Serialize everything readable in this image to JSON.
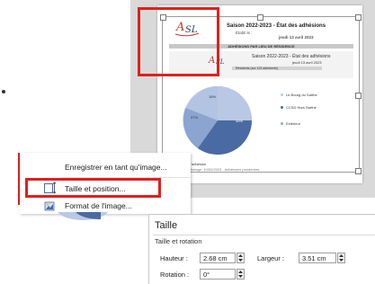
{
  "document": {
    "title": "Saison 2022-2023 - État des adhésions",
    "subtitle": "Établi le :",
    "date": "jeudi 13 avril 2023",
    "band_header": "ADHÉSIONS PAR LIEU DE RÉSIDENCE",
    "inner_title": "Saison 2022-2023 - État des adhésions",
    "inner_date": "jeudi 13 avril 2023",
    "table_row": "Résidents (sur 123 adhérents)",
    "pie_labels": [
      "37%",
      "18%",
      "45%"
    ],
    "legend": [
      "Le Bourg du Sarthe",
      "CCSD Hors Sarthe",
      "Extérieur"
    ],
    "footer_lines": [
      "Seuil d'adhésion",
      "Seuil pilotage: 10/02/2023 - Adhésions pondérées"
    ]
  },
  "context_menu": {
    "items": [
      {
        "label": "Enregistrer en tant qu'image...",
        "icon": "none",
        "mnemonic": "g"
      },
      {
        "label": "Taille et position...",
        "icon": "size-position-icon",
        "mnemonic": "T"
      },
      {
        "label": "Format de l'image...",
        "icon": "format-picture-icon",
        "mnemonic": "o"
      }
    ]
  },
  "size_panel": {
    "heading": "Taille",
    "section": "Taille et rotation",
    "height_label": "Hauteur :",
    "height_value": "2.68 cm",
    "width_label": "Largeur :",
    "width_value": "3.51 cm",
    "rotation_label": "Rotation :",
    "rotation_value": "0°"
  },
  "colors": {
    "highlight": "#e0201c",
    "pie_dark": "#4a6aa3",
    "pie_light": "#b9c8e4",
    "pie_mid": "#7f9acb"
  }
}
